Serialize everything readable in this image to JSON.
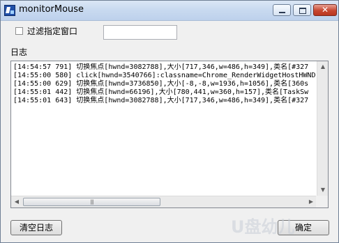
{
  "window": {
    "title": "monitorMouse",
    "controls": {
      "minimize": "minimize",
      "maximize": "maximize",
      "close": "✕"
    }
  },
  "filter": {
    "checkbox_label": "过滤指定窗口",
    "checked": false,
    "input_value": ""
  },
  "log": {
    "label": "日志",
    "lines": [
      "[14:54:57 791] 切换焦点[hwnd=3082788],大小[717,346,w=486,h=349],类名[#327",
      "[14:55:00 580] click[hwnd=3540766]:classname=Chrome_RenderWidgetHostHWND,",
      "[14:55:00 629] 切换焦点[hwnd=3736850],大小[-8,-8,w=1936,h=1056],类名[360s",
      "[14:55:01 442] 切换焦点[hwnd=66196],大小[780,441,w=360,h=157],类名[TaskSw",
      "[14:55:01 643] 切换焦点[hwnd=3082788],大小[717,346,w=486,h=349],类名[#327"
    ]
  },
  "buttons": {
    "clear_label": "清空日志",
    "ok_label": "确定"
  },
  "watermark": "U盘幼儿"
}
